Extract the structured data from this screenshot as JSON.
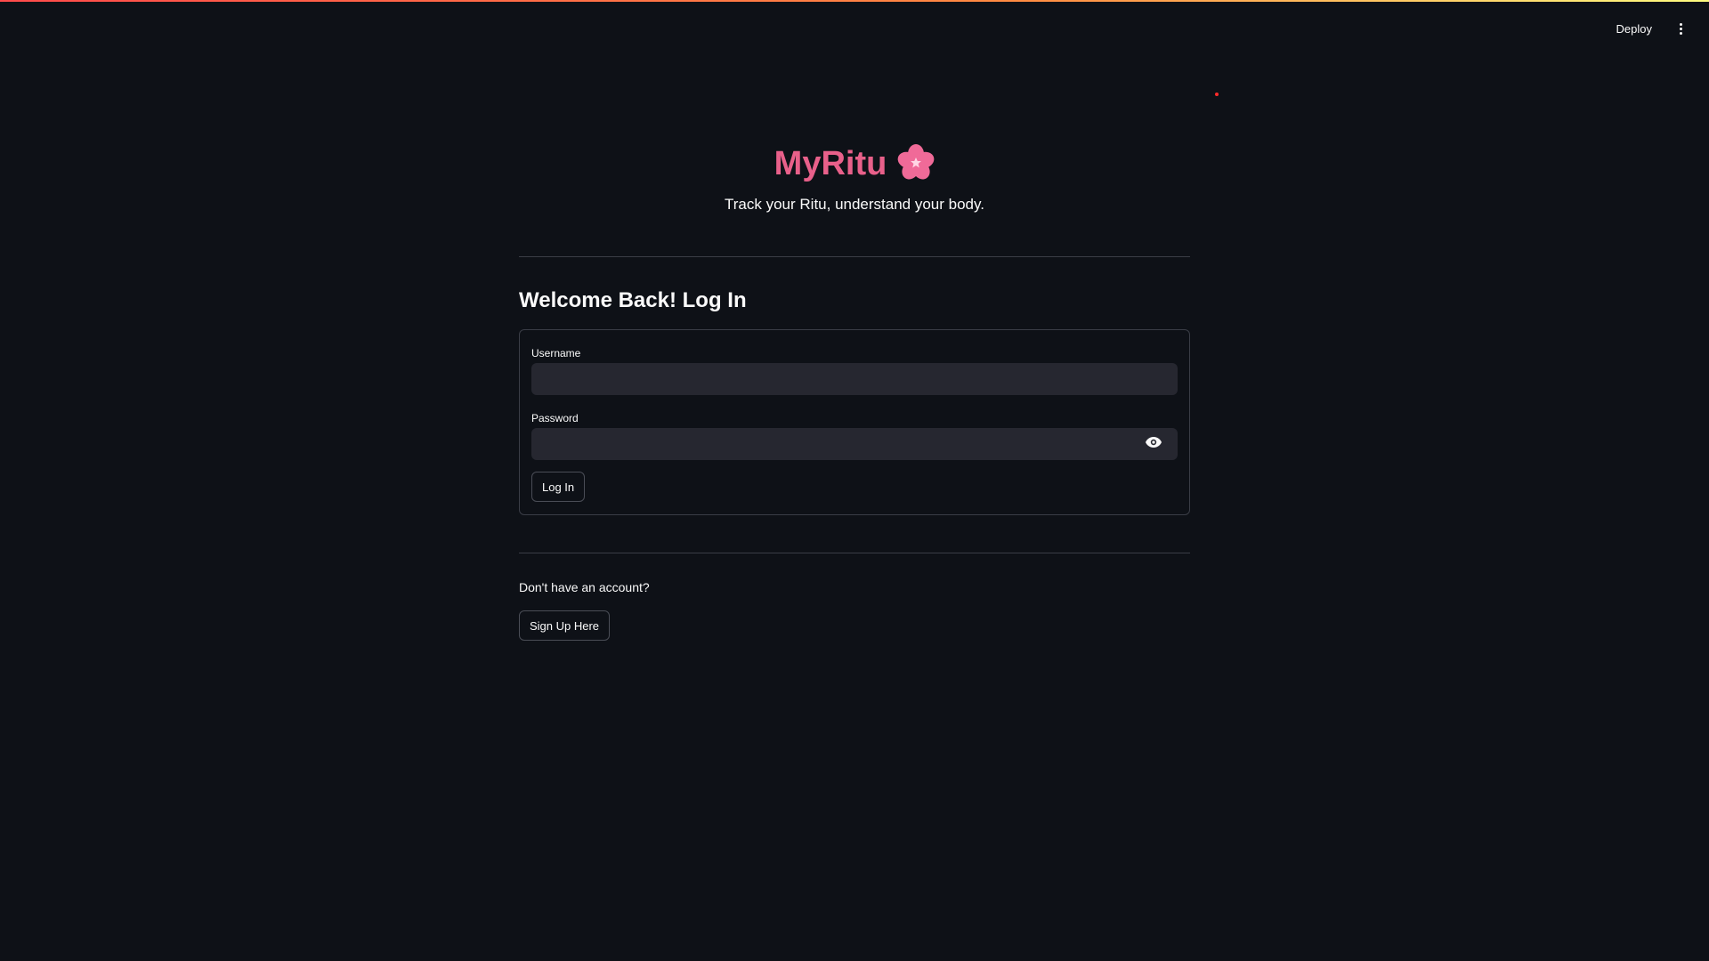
{
  "header": {
    "deploy_label": "Deploy",
    "menu_icon": "more-vertical-icon"
  },
  "app": {
    "title": "MyRitu",
    "title_icon": "flower-icon",
    "tagline": "Track your Ritu, understand your body."
  },
  "login": {
    "heading": "Welcome Back! Log In",
    "username_label": "Username",
    "username_value": "",
    "password_label": "Password",
    "password_value": "",
    "password_toggle_icon": "eye-icon",
    "submit_label": "Log In"
  },
  "signup": {
    "prompt": "Don't have an account?",
    "button_label": "Sign Up Here"
  },
  "colors": {
    "background": "#0e1117",
    "accent": "#e8608a",
    "input_bg": "#262730",
    "text": "#fafafa"
  }
}
